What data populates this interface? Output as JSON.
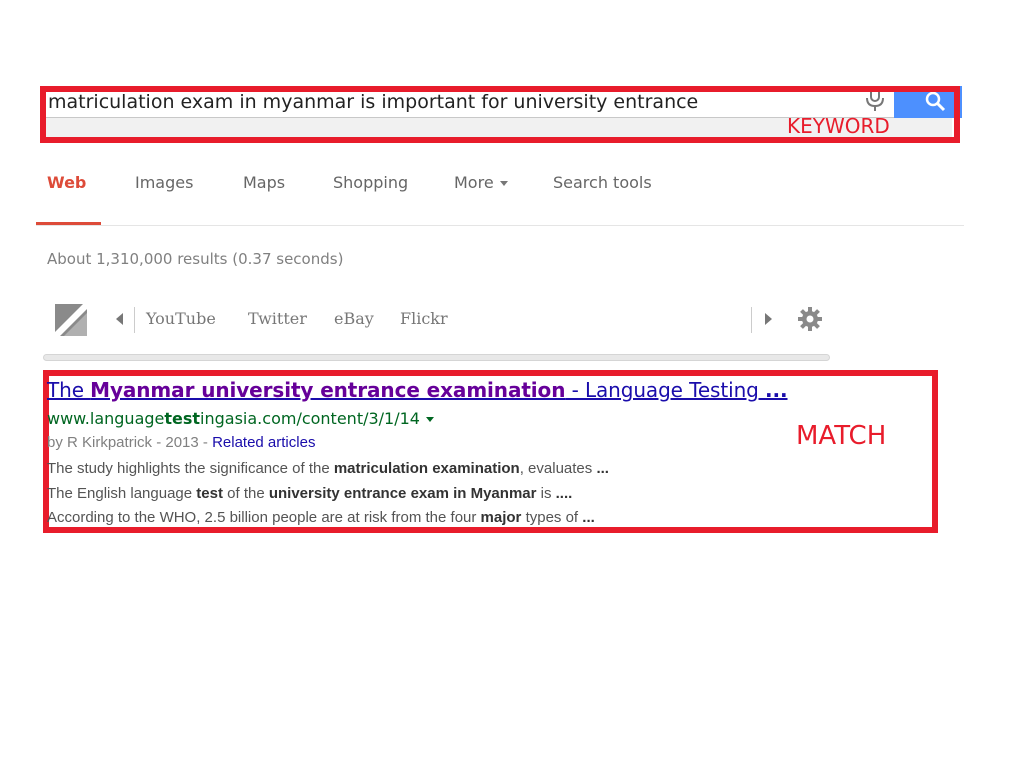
{
  "search": {
    "query": "matriculation exam in myanmar is important for university entrance"
  },
  "tabs": [
    {
      "label": "Web",
      "active": true
    },
    {
      "label": "Images"
    },
    {
      "label": "Maps"
    },
    {
      "label": "Shopping"
    },
    {
      "label": "More",
      "has_dropdown": true
    },
    {
      "label": "Search tools"
    }
  ],
  "result_stats": "About 1,310,000 results (0.37 seconds)",
  "shortcut_bar": {
    "items": [
      "YouTube",
      "Twitter",
      "eBay",
      "Flickr"
    ],
    "icons": [
      "slash-logo-icon",
      "arrow-left-icon",
      "arrow-right-icon",
      "gear-icon"
    ]
  },
  "result": {
    "title_parts": [
      {
        "text": "The ",
        "bold": false
      },
      {
        "text": "Myanmar university entrance examination",
        "bold": true
      },
      {
        "text": " - Language Testing ",
        "bold": false
      },
      {
        "text": "...",
        "bold": true
      }
    ],
    "url_parts": [
      {
        "text": "www.language",
        "bold": false
      },
      {
        "text": "test",
        "bold": true
      },
      {
        "text": "ingasia.com/content/3/1/14",
        "bold": false
      }
    ],
    "meta_prefix": "by R Kirkpatrick - 2013 - ",
    "related_label": "Related articles",
    "snippets": [
      [
        {
          "text": "The study highlights the significance of the ",
          "bold": false
        },
        {
          "text": "matriculation examination",
          "bold": true
        },
        {
          "text": ", evaluates ",
          "bold": false
        },
        {
          "text": "...",
          "bold": true
        }
      ],
      [
        {
          "text": "The English language ",
          "bold": false
        },
        {
          "text": "test",
          "bold": true
        },
        {
          "text": " of the ",
          "bold": false
        },
        {
          "text": "university entrance exam in Myanmar",
          "bold": true
        },
        {
          "text": " is ",
          "bold": false
        },
        {
          "text": "....",
          "bold": true
        }
      ],
      [
        {
          "text": "According to the WHO, 2.5 billion people are at risk from the four ",
          "bold": false
        },
        {
          "text": "major",
          "bold": true
        },
        {
          "text": " types of  ",
          "bold": false
        },
        {
          "text": "...",
          "bold": true
        }
      ]
    ]
  },
  "annotations": {
    "keyword_label": "KEYWORD",
    "match_label": "MATCH"
  },
  "colors": {
    "annotation_red": "#e81c2b",
    "active_tab": "#dd4b39",
    "link_blue": "#1a0dab",
    "visited_purple": "#660099",
    "url_green": "#006621",
    "search_button": "#4d90fe"
  }
}
